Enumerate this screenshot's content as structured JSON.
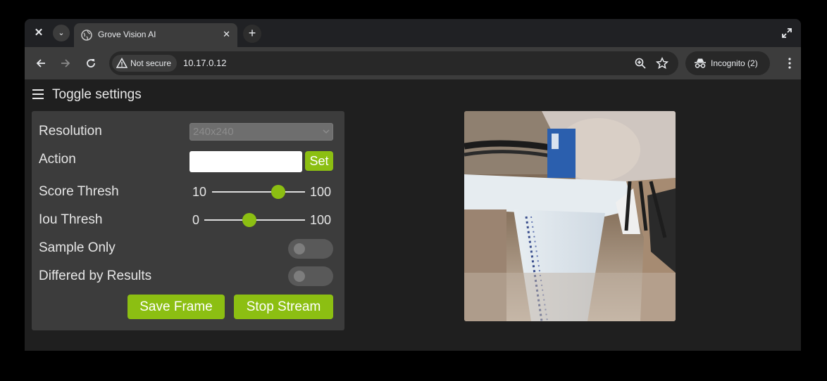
{
  "browser": {
    "tab_title": "Grove Vision AI",
    "security_label": "Not secure",
    "url": "10.17.0.12",
    "incognito_label": "Incognito (2)"
  },
  "page": {
    "toggle_label": "Toggle settings",
    "settings": {
      "resolution_label": "Resolution",
      "resolution_value": "240x240",
      "action_label": "Action",
      "action_value": "",
      "set_label": "Set",
      "score_label": "Score Thresh",
      "score_min": "10",
      "score_max": "100",
      "score_value_fraction": 0.71,
      "iou_label": "Iou Thresh",
      "iou_min": "0",
      "iou_max": "100",
      "iou_value_fraction": 0.45,
      "sample_only_label": "Sample Only",
      "sample_only_on": false,
      "differed_label": "Differed by Results",
      "differed_on": false,
      "save_frame_label": "Save Frame",
      "stop_stream_label": "Stop Stream"
    }
  },
  "colors": {
    "accent": "#8cbf12",
    "panel": "#3c3c3c",
    "page_bg": "#1f1f1f"
  }
}
